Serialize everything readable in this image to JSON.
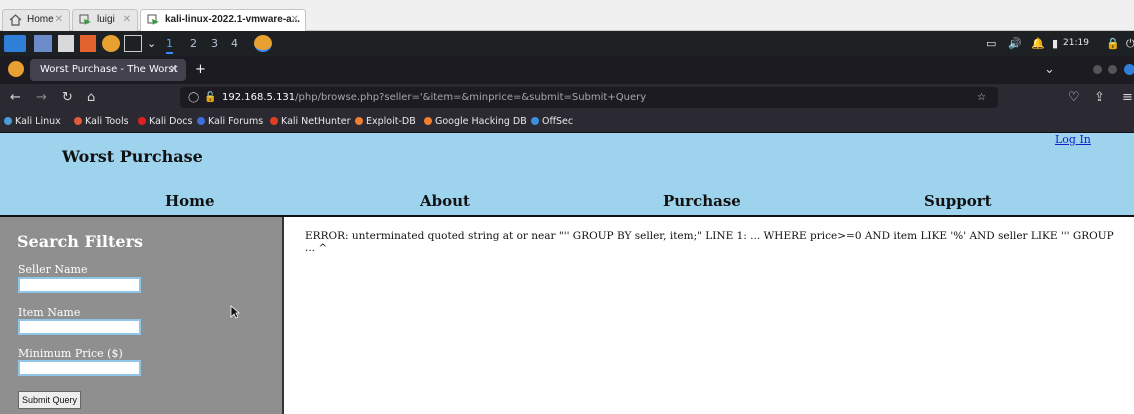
{
  "vm_tabs": [
    {
      "label": "Home",
      "active": false
    },
    {
      "label": "luigi",
      "active": false
    },
    {
      "label": "kali-linux-2022.1-vmware-a...",
      "active": true
    }
  ],
  "kali_panel": {
    "workspaces": [
      "1",
      "2",
      "3",
      "4"
    ],
    "active_workspace": "1",
    "clock": "21:19"
  },
  "browser": {
    "tab_title": "Worst Purchase - The Worst",
    "url_host": "192.168.5.131",
    "url_path": "/php/browse.php?seller='&item=&minprice=&submit=Submit+Query",
    "bookmarks": [
      {
        "label": "Kali Linux",
        "color": "#4a9bd8"
      },
      {
        "label": "Kali Tools",
        "color": "#e05a3a"
      },
      {
        "label": "Kali Docs",
        "color": "#e02020"
      },
      {
        "label": "Kali Forums",
        "color": "#3a6fd8"
      },
      {
        "label": "Kali NetHunter",
        "color": "#e04020"
      },
      {
        "label": "Exploit-DB",
        "color": "#f08030"
      },
      {
        "label": "Google Hacking DB",
        "color": "#f08030"
      },
      {
        "label": "OffSec",
        "color": "#3a8fe0"
      }
    ]
  },
  "site": {
    "title": "Worst Purchase",
    "login": "Log In",
    "menu": [
      "Home",
      "About",
      "Purchase",
      "Support"
    ],
    "colors": {
      "header": "#9ed3ee",
      "sidebar": "#8f8f8f"
    }
  },
  "filters": {
    "title": "Search Filters",
    "seller_label": "Seller Name",
    "item_label": "Item Name",
    "price_label": "Minimum Price ($)",
    "seller_value": "",
    "item_value": "",
    "price_value": "",
    "submit_label": "Submit Query"
  },
  "error": {
    "line1": "ERROR: unterminated quoted string at or near \"'' GROUP BY seller, item;\" LINE 1: ... WHERE price>=0 AND item LIKE '%' AND seller LIKE ''' GROUP",
    "line2": "... ^"
  }
}
